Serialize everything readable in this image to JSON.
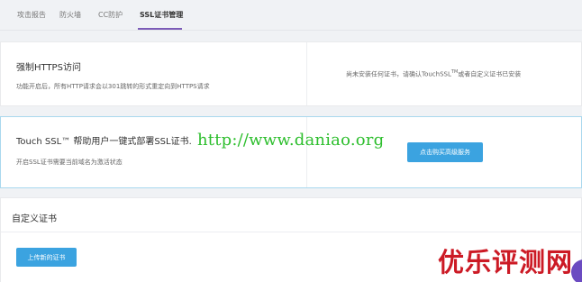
{
  "tabs": [
    {
      "label": "攻击报告"
    },
    {
      "label": "防火墙"
    },
    {
      "label": "CC防护"
    },
    {
      "label": "SSL证书管理"
    }
  ],
  "force_https": {
    "title": "强制HTTPS访问",
    "description": "功能开启后，所有HTTP请求会以301跳转的形式重定向到HTTPS请求",
    "note_prefix": "尚未安装任何证书，请确认TouchSSL",
    "note_tm": "TM",
    "note_suffix": "或者自定义证书已安装"
  },
  "touch_ssl": {
    "title": "Touch SSL™ 帮助用户一键式部署SSL证书.",
    "description": "开启SSL证书需要当前域名为激活状态",
    "button_label": "点击购买高级服务"
  },
  "custom_cert": {
    "title": "自定义证书",
    "button_label": "上传新的证书"
  },
  "watermarks": {
    "url": "http://www.daniao.org",
    "logo": "优乐评测网"
  },
  "colors": {
    "accent_tab": "#7b5bb7",
    "primary_button": "#3ba3e0",
    "url_watermark": "#2dbe2d",
    "logo_watermark": "#cc1a25",
    "highlight_border": "#a9d8ee"
  }
}
